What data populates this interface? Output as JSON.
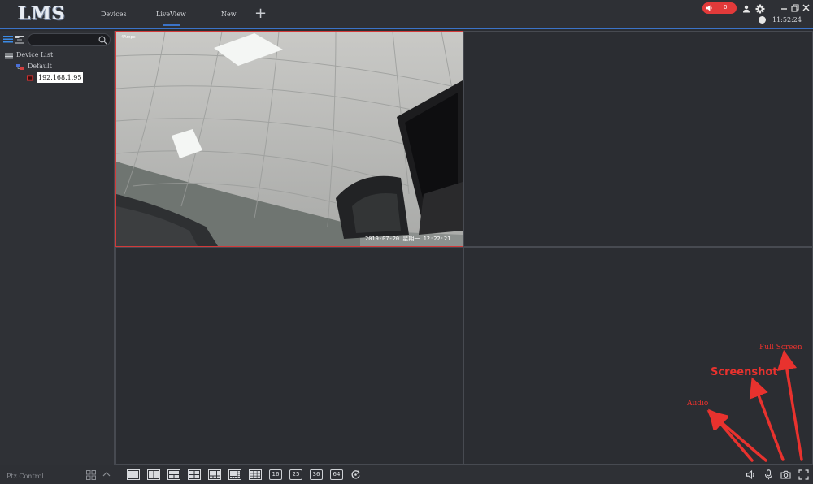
{
  "app": {
    "logo": "LMS"
  },
  "tabs": [
    {
      "label": "Devices"
    },
    {
      "label": "LiveView",
      "active": true
    },
    {
      "label": "New"
    }
  ],
  "header": {
    "alarm_count": "0",
    "time": "11:52:24",
    "accent_color": "#3b73c8",
    "alarm_color": "#e23a3a"
  },
  "sidebar": {
    "search_placeholder": "",
    "tree": {
      "root_label": "Device List",
      "group_label": "Default",
      "device_label": "192.168.1.95"
    }
  },
  "grid": {
    "osd_camera_name": "4Ampx",
    "osd_timestamp": "2019-07-20  星期一  12:22:21",
    "selected_border_color": "#d23a3a"
  },
  "bottom": {
    "ptz_label": "Ptz Control",
    "layout_numbers": [
      "16",
      "25",
      "36",
      "64"
    ]
  },
  "annotations": {
    "full_screen": "Full Screen",
    "screenshot": "Screenshot",
    "audio": "Audio",
    "color": "#e8322e"
  }
}
